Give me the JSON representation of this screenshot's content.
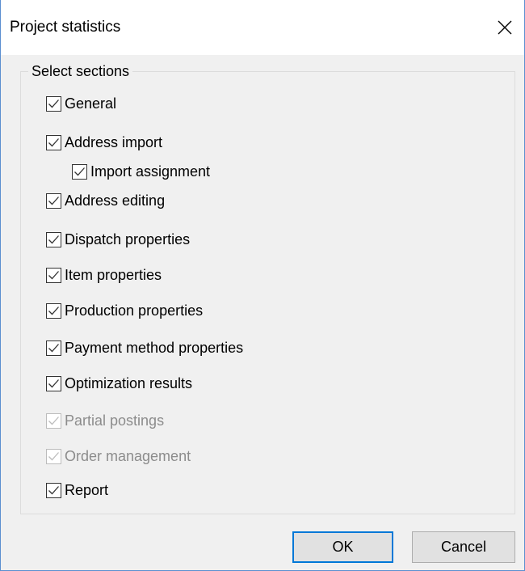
{
  "dialog": {
    "title": "Project statistics",
    "close_icon": "close-icon"
  },
  "group": {
    "label": "Select sections",
    "items": [
      {
        "label": "General",
        "checked": true,
        "enabled": true
      },
      {
        "label": "Address import",
        "checked": true,
        "enabled": true
      },
      {
        "label": "Import assignment",
        "checked": true,
        "enabled": true,
        "indented": true
      },
      {
        "label": "Address editing",
        "checked": true,
        "enabled": true
      },
      {
        "label": "Dispatch properties",
        "checked": true,
        "enabled": true
      },
      {
        "label": "Item properties",
        "checked": true,
        "enabled": true
      },
      {
        "label": "Production properties",
        "checked": true,
        "enabled": true
      },
      {
        "label": "Payment method properties",
        "checked": true,
        "enabled": true
      },
      {
        "label": "Optimization results",
        "checked": true,
        "enabled": true
      },
      {
        "label": "Partial postings",
        "checked": true,
        "enabled": false
      },
      {
        "label": "Order management",
        "checked": true,
        "enabled": false
      },
      {
        "label": "Report",
        "checked": true,
        "enabled": true
      }
    ]
  },
  "buttons": {
    "ok_label": "OK",
    "cancel_label": "Cancel"
  },
  "colors": {
    "accent": "#0078d7",
    "window_border": "#5b8fd0",
    "dialog_background": "#f0f0f0",
    "disabled_text": "#8c8c8c"
  }
}
